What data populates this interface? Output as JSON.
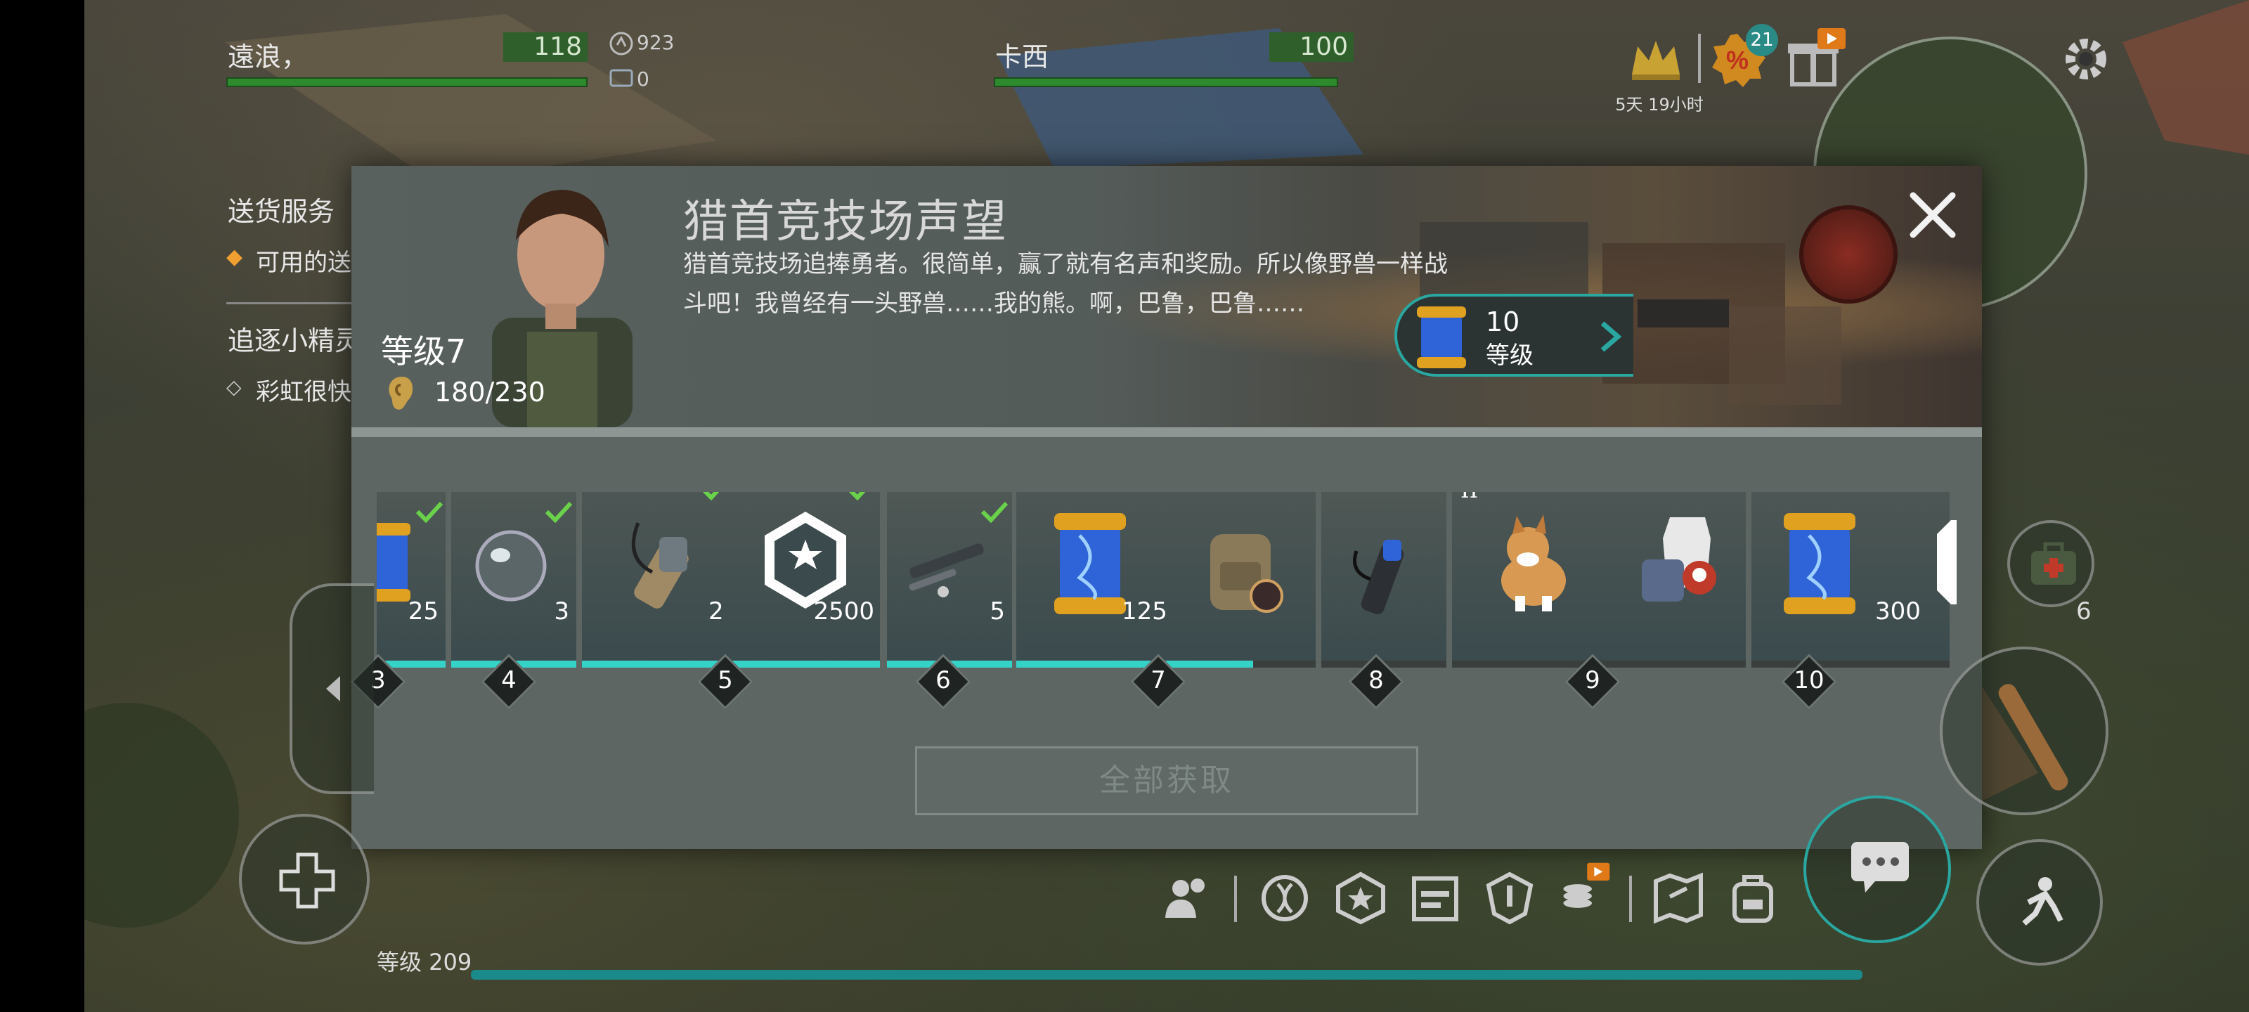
{
  "hud": {
    "player1": {
      "name": "遠浪，",
      "hp": "118"
    },
    "player2": {
      "name": "卡西",
      "hp": "100"
    },
    "currency1": "923",
    "currency2": "0",
    "event_timer": "5天 19小时",
    "promo_badge_count": "21"
  },
  "quests": [
    {
      "title": "送货服务",
      "sub": "可用的送"
    },
    {
      "title": "追逐小精灵",
      "sub": "彩虹很快"
    }
  ],
  "modal": {
    "title": "猎首竞技场声望",
    "description": "猎首竞技场追捧勇者。很简单，赢了就有名声和奖励。所以像野兽一样战斗吧！我曾经有一头野兽……我的熊。啊，巴鲁，巴鲁……",
    "level_label": "等级7",
    "reputation": "180/230",
    "collect_all_label": "全部获取",
    "next_tag": {
      "value": "10",
      "label": "等级"
    },
    "tiers": [
      {
        "level": "3",
        "items": [
          {
            "icon": "gene-capsule-icon",
            "count": "25"
          }
        ],
        "claimed": true
      },
      {
        "level": "4",
        "items": [
          {
            "icon": "lens-icon",
            "count": "3"
          }
        ],
        "claimed": true
      },
      {
        "level": "5",
        "items": [
          {
            "icon": "binoculars-icon",
            "count": "2"
          },
          {
            "icon": "arena-emblem-icon",
            "count": "2500"
          }
        ],
        "claimed": true
      },
      {
        "level": "6",
        "items": [
          {
            "icon": "rifle-scope-icon",
            "count": "5"
          }
        ],
        "claimed": true
      },
      {
        "level": "7",
        "items": [
          {
            "icon": "gene-capsule-icon",
            "count": "125"
          },
          {
            "icon": "backpack-icon",
            "count": ""
          }
        ],
        "claimed": false
      },
      {
        "level": "8",
        "items": [
          {
            "icon": "silencer-icon",
            "count": ""
          }
        ],
        "claimed": false
      },
      {
        "level": "9",
        "roman": "II",
        "items": [
          {
            "icon": "corgi-icon",
            "count": ""
          },
          {
            "icon": "outfit-icon",
            "count": ""
          }
        ],
        "claimed": false
      },
      {
        "level": "10",
        "items": [
          {
            "icon": "gene-capsule-icon",
            "count": "300"
          }
        ],
        "claimed": false
      }
    ]
  },
  "right_hud": {
    "ammo_count": "6"
  },
  "bottom": {
    "player_level": "等级 209"
  },
  "colors": {
    "accent": "#35d2c8",
    "hp_green": "#2d8a2d",
    "check_green": "#6ad24a"
  }
}
